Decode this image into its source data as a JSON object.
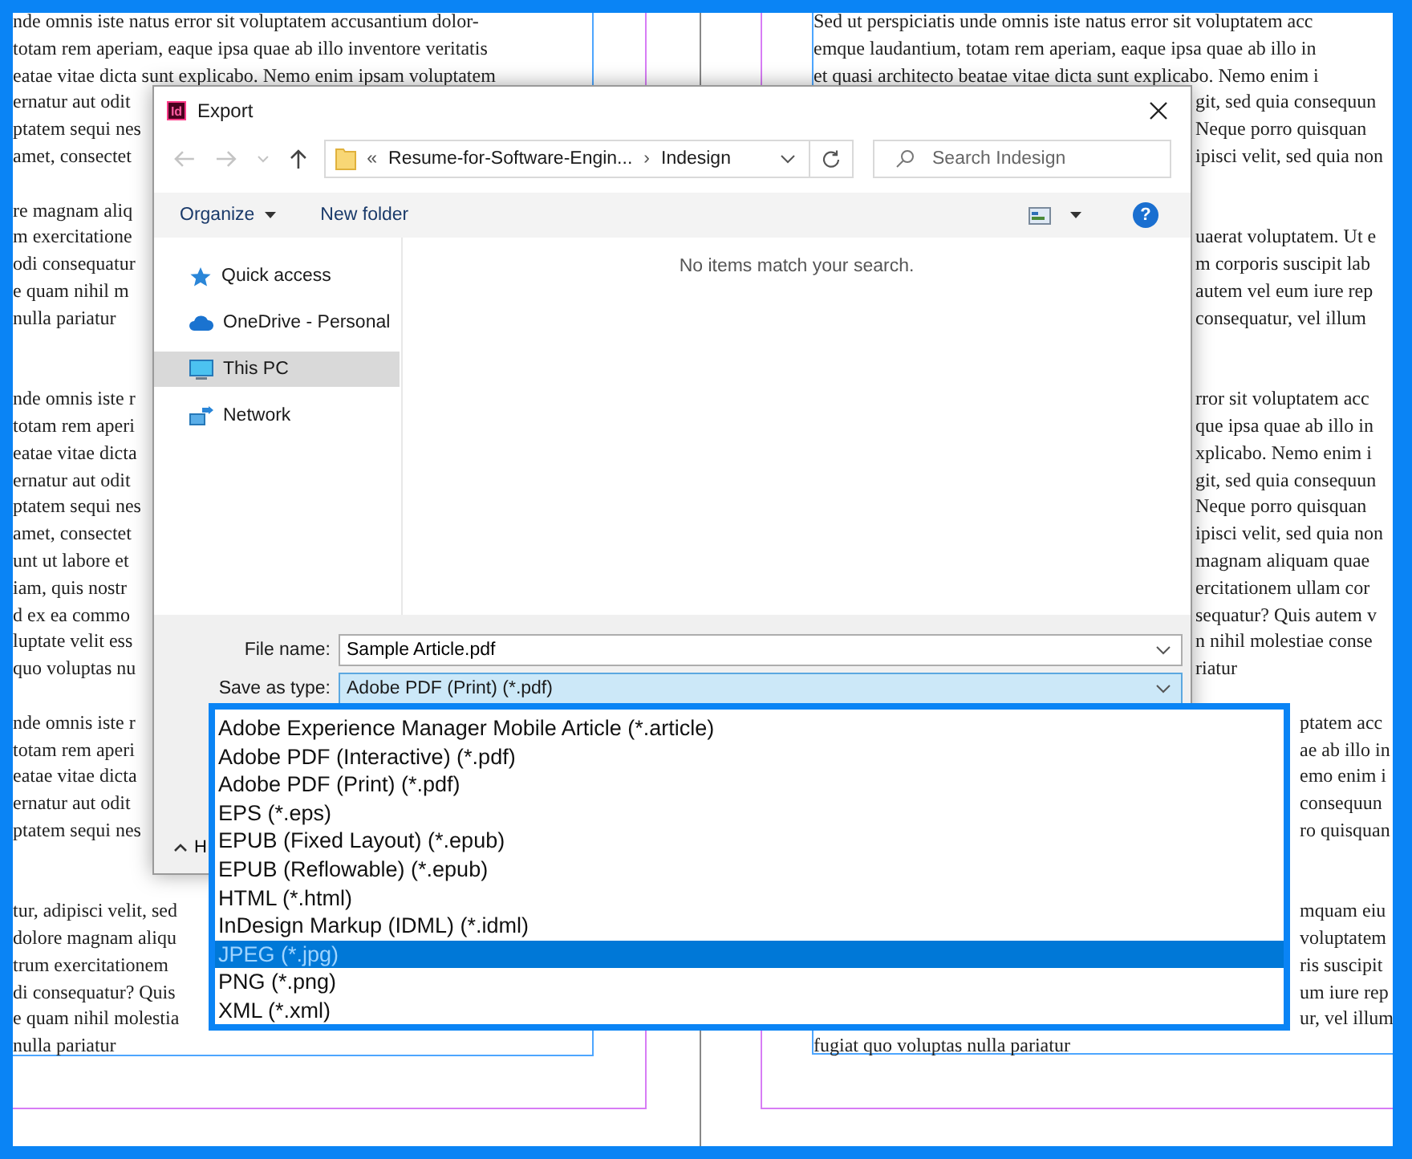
{
  "document": {
    "left_column": [
      {
        "lines": [
          "nde omnis iste natus error sit voluptatem accusantium dolor-",
          "totam rem aperiam, eaque ipsa quae ab illo inventore veritatis",
          "eatae vitae dicta sunt explicabo. Nemo enim ipsam voluptatem",
          "ernatur aut odit",
          "ptatem sequi nes",
          "amet, consectet"
        ]
      },
      {
        "lines": [
          "re magnam aliq",
          "m exercitatione",
          "odi consequatur",
          "e quam nihil m",
          "nulla pariatur"
        ]
      },
      {
        "lines": [
          "nde omnis iste r",
          "totam rem aperi",
          "eatae vitae dicta",
          "ernatur aut odit",
          "ptatem sequi nes",
          "amet, consectet",
          "unt ut labore et",
          "iam, quis nostr",
          "d ex ea commo",
          "luptate velit ess",
          "quo voluptas nu"
        ]
      },
      {
        "lines": [
          "nde omnis iste r",
          "totam rem aperi",
          "eatae vitae dicta",
          "ernatur aut odit",
          "ptatem sequi nes"
        ]
      },
      {
        "lines": [
          "tur, adipisci velit, sed",
          "dolore magnam aliqu",
          "trum exercitationem",
          "di consequatur? Quis",
          "e quam nihil molestia",
          "nulla pariatur"
        ]
      }
    ],
    "right_column": [
      {
        "lines": [
          {
            "text": "Sed ut perspiciatis unde omnis iste natus error sit voluptatem acc",
            "kind": "full"
          },
          {
            "text": "emque laudantium, totam rem aperiam, eaque ipsa quae ab illo in",
            "kind": "full"
          },
          {
            "text": "et quasi architecto beatae vitae dicta sunt explicabo. Nemo enim i",
            "kind": "full"
          },
          {
            "text": "git, sed quia consequun",
            "kind": "after-dialog"
          },
          {
            "text": "Neque porro quisquan",
            "kind": "after-dialog"
          },
          {
            "text": "ipisci velit, sed quia non",
            "kind": "after-dialog"
          }
        ]
      },
      {
        "lines": [
          {
            "text": "uaerat voluptatem. Ut e",
            "kind": "after-dialog"
          },
          {
            "text": "m corporis suscipit lab",
            "kind": "after-dialog"
          },
          {
            "text": "autem vel eum iure rep",
            "kind": "after-dialog"
          },
          {
            "text": "consequatur, vel illum",
            "kind": "after-dialog"
          }
        ]
      },
      {
        "lines": [
          {
            "text": "rror sit voluptatem acc",
            "kind": "after-dialog"
          },
          {
            "text": "que ipsa quae ab illo in",
            "kind": "after-dialog"
          },
          {
            "text": "xplicabo. Nemo enim i",
            "kind": "after-dialog"
          },
          {
            "text": "git, sed quia consequun",
            "kind": "after-dialog"
          },
          {
            "text": "Neque porro quisquan",
            "kind": "after-dialog"
          },
          {
            "text": "ipisci velit, sed quia non",
            "kind": "after-dialog"
          },
          {
            "text": "magnam aliquam quae",
            "kind": "after-dialog"
          },
          {
            "text": "ercitationem ullam cor",
            "kind": "after-dialog"
          },
          {
            "text": "sequatur? Quis autem v",
            "kind": "after-dialog"
          },
          {
            "text": "n nihil molestiae conse",
            "kind": "after-dialog"
          },
          {
            "text": "riatur",
            "kind": "after-dialog"
          }
        ]
      },
      {
        "lines": [
          {
            "text": "ptatem acc",
            "kind": "after-menu"
          },
          {
            "text": "ae ab illo in",
            "kind": "after-menu"
          },
          {
            "text": "emo enim i",
            "kind": "after-menu"
          },
          {
            "text": "consequun",
            "kind": "after-menu"
          },
          {
            "text": "ro quisquan",
            "kind": "after-menu"
          }
        ]
      },
      {
        "lines": [
          {
            "text": "mquam eiu",
            "kind": "after-menu"
          },
          {
            "text": "voluptatem",
            "kind": "after-menu"
          },
          {
            "text": "ris suscipit",
            "kind": "after-menu"
          },
          {
            "text": "um iure rep",
            "kind": "after-menu"
          },
          {
            "text": "ur, vel illum",
            "kind": "after-menu"
          },
          {
            "text": "fugiat quo voluptas nulla pariatur",
            "kind": "full"
          }
        ]
      }
    ]
  },
  "dialog": {
    "app_badge": "Id",
    "title": "Export",
    "address": [
      "«",
      "Resume-for-Software-Engin...",
      "›",
      "Indesign"
    ],
    "search": {
      "placeholder": "Search Indesign"
    },
    "toolbar": {
      "organize": "Organize",
      "new_folder": "New folder",
      "help": "?"
    },
    "nav_items": [
      {
        "label": "Quick access",
        "kind": "star",
        "selected": false
      },
      {
        "label": "OneDrive - Personal",
        "kind": "cloud",
        "selected": false
      },
      {
        "label": "This PC",
        "kind": "computer",
        "selected": true
      },
      {
        "label": "Network",
        "kind": "network",
        "selected": false
      }
    ],
    "empty_message": "No items match your search.",
    "file_name": {
      "label": "File name:",
      "value": "Sample Article.pdf"
    },
    "save_as_type": {
      "label": "Save as type:",
      "value": "Adobe PDF (Print) (*.pdf)"
    },
    "hide_folders": "H"
  },
  "type_menu": [
    {
      "label": "Adobe Experience Manager Mobile Article (*.article)",
      "selected": false
    },
    {
      "label": "Adobe PDF (Interactive) (*.pdf)",
      "selected": false
    },
    {
      "label": "Adobe PDF (Print) (*.pdf)",
      "selected": false
    },
    {
      "label": "EPS (*.eps)",
      "selected": false
    },
    {
      "label": "EPUB (Fixed Layout) (*.epub)",
      "selected": false
    },
    {
      "label": "EPUB (Reflowable) (*.epub)",
      "selected": false
    },
    {
      "label": "HTML (*.html)",
      "selected": false
    },
    {
      "label": "InDesign Markup (IDML) (*.idml)",
      "selected": false
    },
    {
      "label": "JPEG (*.jpg)",
      "selected": true
    },
    {
      "label": "PNG (*.png)",
      "selected": false
    },
    {
      "label": "XML (*.xml)",
      "selected": false
    }
  ]
}
